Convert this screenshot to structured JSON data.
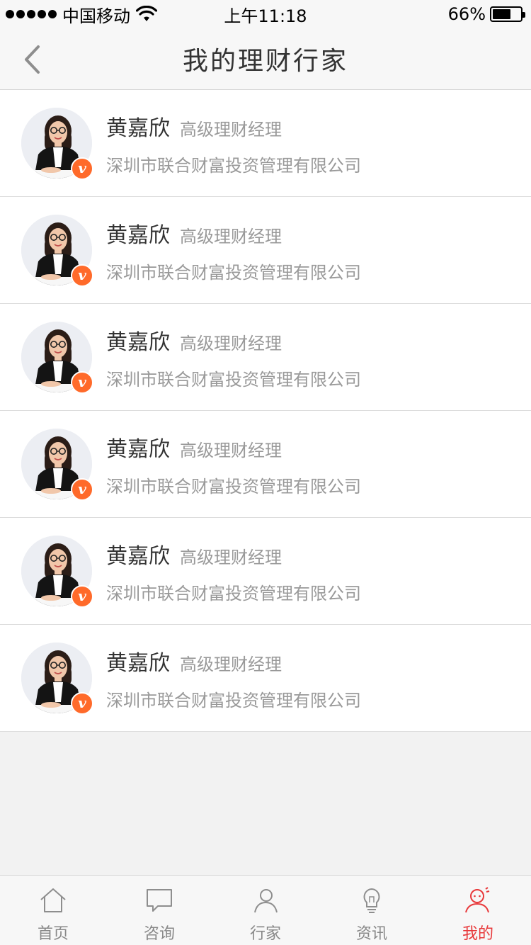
{
  "status_bar": {
    "carrier": "中国移动",
    "time": "上午11:18",
    "battery_percent": "66%",
    "battery_level": 0.66
  },
  "nav": {
    "title": "我的理财行家",
    "back_icon": "chevron-left-icon"
  },
  "advisors": [
    {
      "name": "黄嘉欣",
      "title": "高级理财经理",
      "company": "深圳市联合财富投资管理有限公司",
      "badge": "v"
    },
    {
      "name": "黄嘉欣",
      "title": "高级理财经理",
      "company": "深圳市联合财富投资管理有限公司",
      "badge": "v"
    },
    {
      "name": "黄嘉欣",
      "title": "高级理财经理",
      "company": "深圳市联合财富投资管理有限公司",
      "badge": "v"
    },
    {
      "name": "黄嘉欣",
      "title": "高级理财经理",
      "company": "深圳市联合财富投资管理有限公司",
      "badge": "v"
    },
    {
      "name": "黄嘉欣",
      "title": "高级理财经理",
      "company": "深圳市联合财富投资管理有限公司",
      "badge": "v"
    },
    {
      "name": "黄嘉欣",
      "title": "高级理财经理",
      "company": "深圳市联合财富投资管理有限公司",
      "badge": "v"
    }
  ],
  "tab_bar": {
    "tabs": [
      {
        "label": "首页",
        "icon": "home-icon",
        "active": false
      },
      {
        "label": "咨询",
        "icon": "chat-bubble-icon",
        "active": false
      },
      {
        "label": "行家",
        "icon": "person-icon",
        "active": false
      },
      {
        "label": "资讯",
        "icon": "lightbulb-icon",
        "active": false
      },
      {
        "label": "我的",
        "icon": "user-profile-icon",
        "active": true
      }
    ]
  },
  "colors": {
    "accent": "#e8393b",
    "badge": "#ff6a2a",
    "inactive_tab": "#888888",
    "secondary_text": "#999999"
  }
}
